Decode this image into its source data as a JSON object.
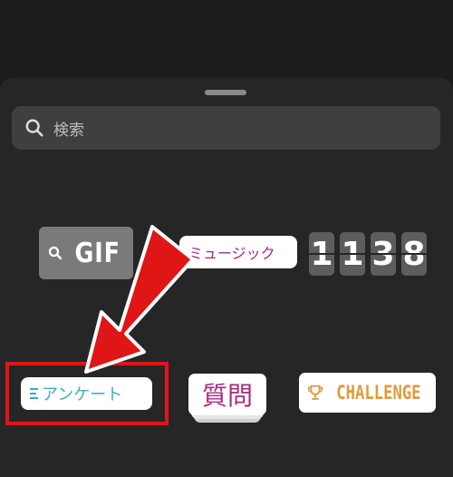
{
  "search": {
    "placeholder": "検索"
  },
  "stickers": {
    "gif": {
      "label": "GIF"
    },
    "music": {
      "label": "ミュージック"
    },
    "countdown": {
      "digits": [
        "1",
        "1",
        "3",
        "8"
      ]
    },
    "poll": {
      "label": "アンケート"
    },
    "question": {
      "label": "質問"
    },
    "challenge": {
      "label": "CHALLENGE"
    }
  },
  "colors": {
    "background": "#1c1c1c",
    "sheet": "#262626",
    "annotation_red": "#e01515",
    "poll_text": "#4aa9c2",
    "question_text": "#a92a7c",
    "challenge_text": "#e29a3c"
  },
  "icons": {
    "search": "magnifier-icon",
    "challenge": "trophy-icon"
  }
}
